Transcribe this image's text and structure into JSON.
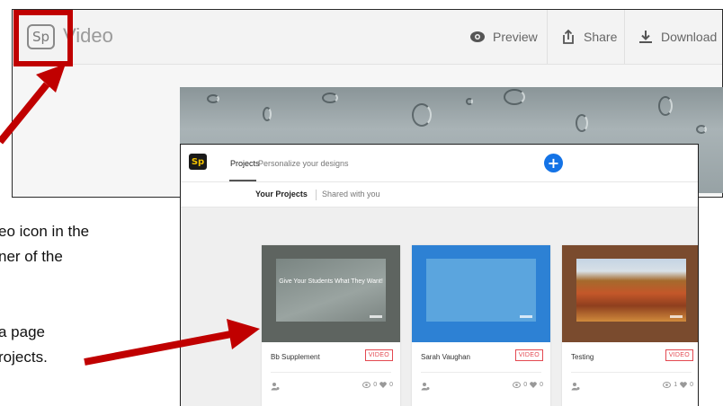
{
  "back_window": {
    "logo": "Sp",
    "app_name": "Video",
    "actions": [
      {
        "label": "Preview",
        "icon": "eye-icon"
      },
      {
        "label": "Share",
        "icon": "share-icon"
      },
      {
        "label": "Download",
        "icon": "download-icon"
      }
    ]
  },
  "front_window": {
    "logo": "Sp",
    "nav": {
      "projects_tab": "Projects",
      "personalize_tab": "Personalize your designs"
    },
    "create_button": "+",
    "subtabs": {
      "yours": "Your Projects",
      "shared": "Shared with you"
    },
    "cards": [
      {
        "title": "Bb Supplement",
        "badge": "VIDEO",
        "views": "0",
        "likes": "0",
        "thumb_text": "Give Your Students What They Want!"
      },
      {
        "title": "Sarah Vaughan",
        "badge": "VIDEO",
        "views": "0",
        "likes": "0"
      },
      {
        "title": "Testing",
        "badge": "VIDEO",
        "views": "1",
        "likes": "0"
      }
    ]
  },
  "caption": {
    "line1": "eo icon in the",
    "line2": "ner of the",
    "line3": "a page",
    "line4": "rojects."
  },
  "colors": {
    "callout": "#c00000",
    "accent_blue": "#1473e6",
    "badge_red": "#e34850"
  }
}
